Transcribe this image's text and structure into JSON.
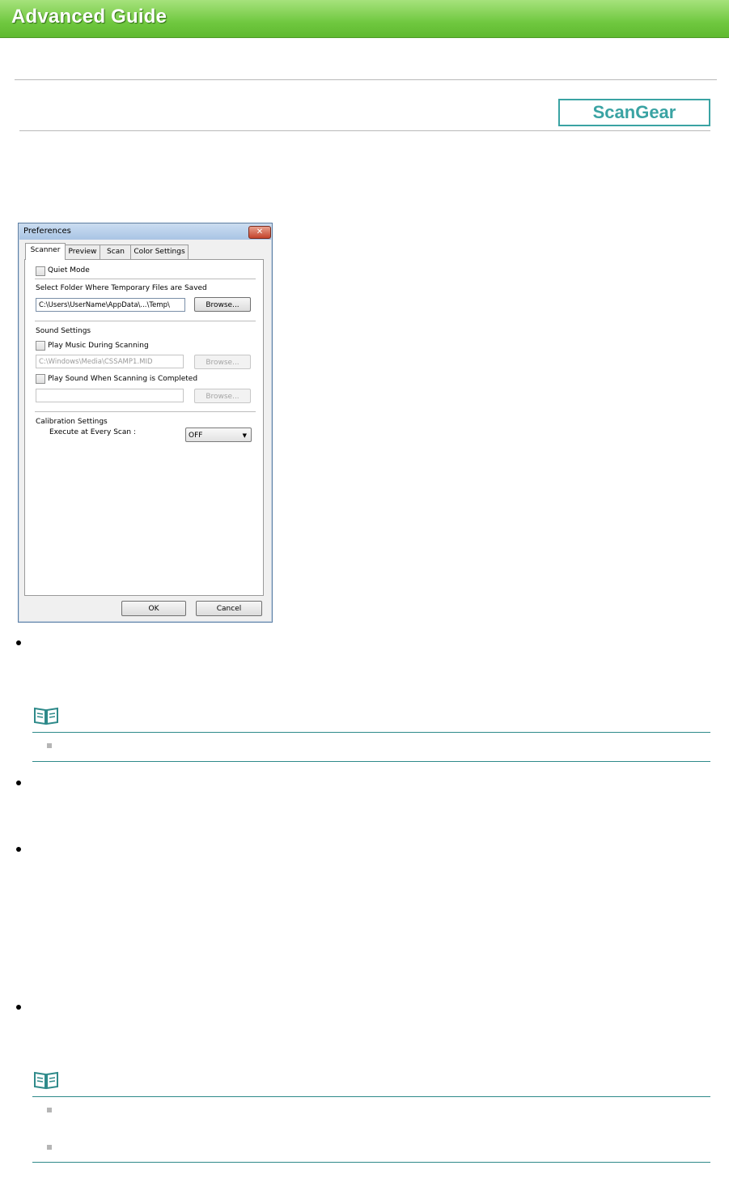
{
  "header": {
    "title": "Advanced Guide"
  },
  "badge": {
    "label": "ScanGear"
  },
  "dialog": {
    "title": "Preferences",
    "close_glyph": "✕",
    "tabs": [
      "Scanner",
      "Preview",
      "Scan",
      "Color Settings"
    ],
    "quiet_mode_label": "Quiet Mode",
    "temp_folder_label": "Select Folder Where Temporary Files are Saved",
    "temp_folder_value": "C:\\Users\\UserName\\AppData\\...\\Temp\\",
    "browse_label": "Browse...",
    "sound_settings_label": "Sound Settings",
    "play_music_label": "Play Music During Scanning",
    "music_file_value": "C:\\Windows\\Media\\CSSAMP1.MID",
    "play_sound_label": "Play Sound When Scanning is Completed",
    "sound_file_value": "",
    "calibration_label": "Calibration Settings",
    "execute_label": "Execute at Every Scan :",
    "execute_value": "OFF",
    "ok_label": "OK",
    "cancel_label": "Cancel"
  },
  "colors": {
    "banner": "#70c840",
    "accent_teal": "#3aa3a3",
    "dialog_border": "#5b7fa6"
  }
}
